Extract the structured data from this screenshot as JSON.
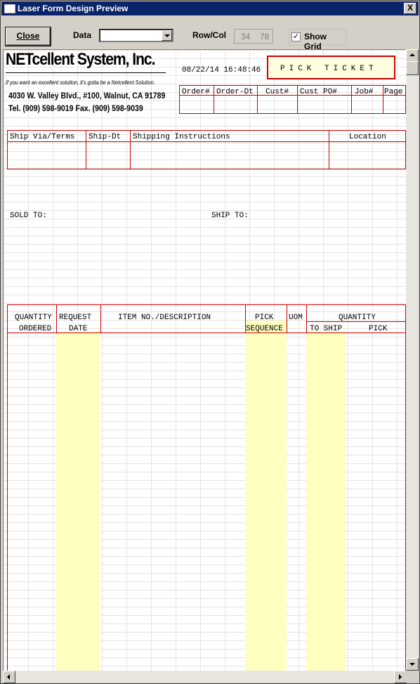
{
  "window": {
    "title": "Laser Form Design Preview",
    "close_glyph": "X"
  },
  "toolbar": {
    "close_label": "Close",
    "data_label": "Data",
    "data_value": "",
    "rowcol_label": "Row/Col",
    "row_value": "34",
    "col_value": "78",
    "show_grid_label": "Show Grid",
    "show_grid_checked": true,
    "check_glyph": "✓"
  },
  "form": {
    "company_name": "NETcellent System, Inc.",
    "tagline": "If you want an excellent solution, it's gotta be a Netcellent Solution.",
    "address": "4030 W. Valley Blvd., #100,  Walnut, CA 91789",
    "phone": "Tel. (909) 598-9019   Fax. (909) 598-9039",
    "datetime": "08/22/14 16:48:46",
    "doc_title": "PICK TICKET",
    "header_cols": [
      "Order#",
      "Order-Dt",
      "Cust#",
      "Cust PO#",
      "Job#",
      "Page"
    ],
    "ship_cols": [
      "Ship Via/Terms",
      "Ship-Dt",
      "Shipping Instructions",
      "Location"
    ],
    "sold_to": "SOLD TO:",
    "ship_to": "SHIP TO:",
    "line_cols": {
      "qty_top": "QUANTITY",
      "qty_bottom": "ORDERED",
      "req_top": "REQUEST",
      "req_bottom": "DATE",
      "item": "ITEM NO./DESCRIPTION",
      "pick_top": "PICK",
      "pick_bottom": "SEQUENCE",
      "uom": "UOM",
      "qty2_top": "QUANTITY",
      "qty2_a": "TO SHIP",
      "qty2_b": "PICK"
    }
  },
  "colors": {
    "accent_red": "#cc0000",
    "highlight_yellow": "#ffffc0",
    "titlebar": "#0a246a"
  }
}
